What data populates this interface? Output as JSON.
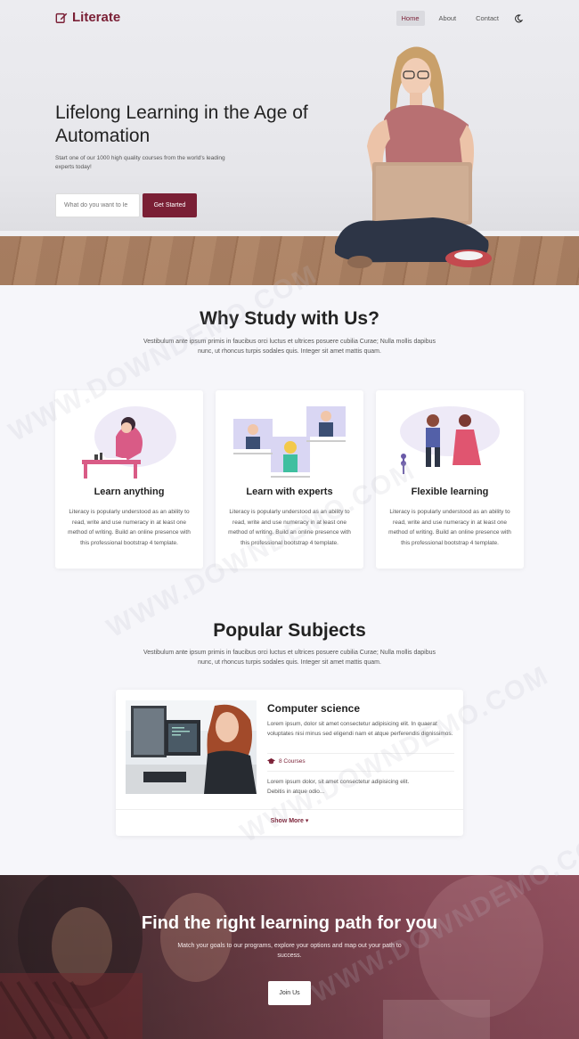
{
  "nav": {
    "brand": "Literate",
    "links": [
      "Home",
      "About",
      "Contact"
    ]
  },
  "hero": {
    "title": "Lifelong Learning in the Age of Automation",
    "subtitle": "Start one of our 1000 high quality courses from the world's leading experts today!",
    "search_placeholder": "What do you want to le",
    "cta_label": "Get Started"
  },
  "why": {
    "title": "Why Study with Us?",
    "subtitle": "Vestibulum ante ipsum primis in faucibus orci luctus et ultrices posuere cubilia Curae; Nulla mollis dapibus nunc, ut rhoncus turpis sodales quis. Integer sit amet mattis quam.",
    "cards": [
      {
        "title": "Learn anything",
        "text": "Literacy is popularly understood as an ability to read, write and use numeracy in at least one method of writing. Build an online presence with this professional bootstrap 4 template."
      },
      {
        "title": "Learn with experts",
        "text": "Literacy is popularly understood as an ability to read, write and use numeracy in at least one method of writing. Build an online presence with this professional bootstrap 4 template."
      },
      {
        "title": "Flexible learning",
        "text": "Literacy is popularly understood as an ability to read, write and use numeracy in at least one method of writing. Build an online presence with this professional bootstrap 4 template."
      }
    ]
  },
  "popular": {
    "title": "Popular Subjects",
    "subtitle": "Vestibulum ante ipsum primis in faucibus orci luctus et ultrices posuere cubilia Curae; Nulla mollis dapibus nunc, ut rhoncus turpis sodales quis. Integer sit amet mattis quam.",
    "course": {
      "title": "Computer science",
      "desc": "Lorem ipsum, dolor sit amet consectetur adipisicing elit. In quaerat voluptates nisi minus sed eligendi nam et atque perferendis dignissimos.",
      "count": "8 Courses",
      "desc2": "Lorem ipsum dolor, sit amet consectetur adipisicing elit. Debitis in atque odio..."
    },
    "show_more": "Show More"
  },
  "cta": {
    "title": "Find the right learning path for you",
    "subtitle": "Match your goals to our programs, explore your options and map out your path to success.",
    "button": "Join Us"
  },
  "watermark": "WWW.DOWNDEMO.COM",
  "colors": {
    "primary": "#7a1f35",
    "background": "#f6f6fa"
  }
}
